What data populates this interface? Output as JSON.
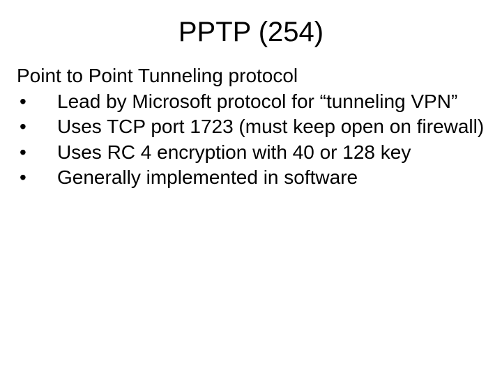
{
  "title": "PPTP (254)",
  "subtitle": "Point to Point Tunneling protocol",
  "bullets": [
    "Lead by Microsoft protocol for “tunneling VPN”",
    "Uses TCP port 1723 (must keep open on firewall)",
    "Uses RC 4 encryption with 40 or 128 key",
    "Generally implemented in software"
  ]
}
